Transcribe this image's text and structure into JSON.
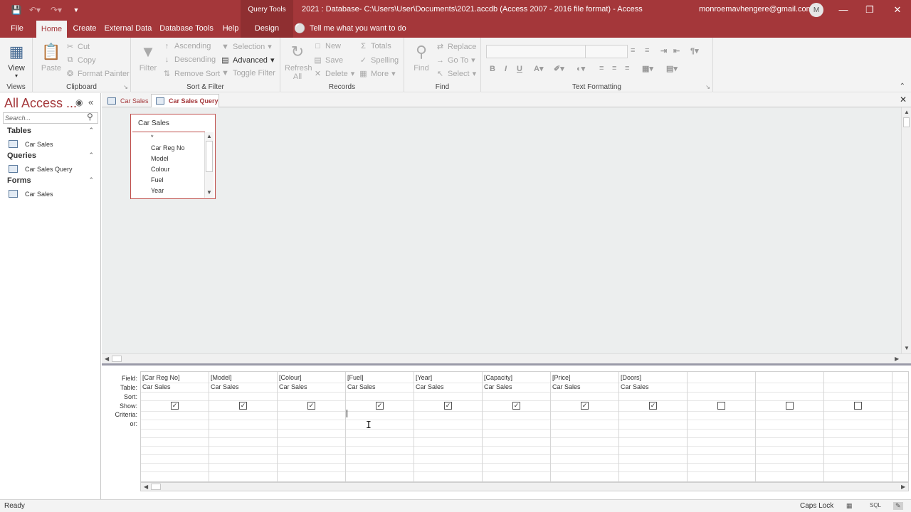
{
  "titlebar": {
    "context_tab_title": "Query Tools",
    "window_title": "2021 : Database- C:\\Users\\User\\Documents\\2021.accdb (Access 2007 - 2016 file format)  -  Access",
    "account_email": "monroemavhengere@gmail.com",
    "avatar_initial": "M",
    "qat_icons": [
      "save-icon",
      "undo-icon",
      "redo-icon",
      "customize-qat-icon"
    ]
  },
  "tabs": {
    "file": "File",
    "home": "Home",
    "create": "Create",
    "external_data": "External Data",
    "database_tools": "Database Tools",
    "help": "Help",
    "design": "Design",
    "tell_me": "Tell me what you want to do"
  },
  "ribbon": {
    "views": {
      "label": "Views",
      "view_button": "View"
    },
    "clipboard": {
      "label": "Clipboard",
      "paste": "Paste",
      "cut": "Cut",
      "copy": "Copy",
      "format_painter": "Format Painter"
    },
    "sort_filter": {
      "label": "Sort & Filter",
      "filter": "Filter",
      "ascending": "Ascending",
      "descending": "Descending",
      "remove_sort": "Remove Sort",
      "selection": "Selection",
      "advanced": "Advanced",
      "toggle_filter": "Toggle Filter"
    },
    "records": {
      "label": "Records",
      "refresh_all": "Refresh",
      "refresh_all_2": "All",
      "new": "New",
      "save": "Save",
      "delete": "Delete",
      "totals": "Totals",
      "spelling": "Spelling",
      "more": "More"
    },
    "find": {
      "label": "Find",
      "find": "Find",
      "replace": "Replace",
      "go_to": "Go To",
      "select": "Select"
    },
    "text_formatting": {
      "label": "Text Formatting",
      "bold": "B",
      "italic": "I",
      "underline": "U"
    }
  },
  "nav": {
    "title": "All Access ...",
    "search_placeholder": "Search...",
    "sections": [
      {
        "header": "Tables",
        "items": [
          "Car Sales"
        ]
      },
      {
        "header": "Queries",
        "items": [
          "Car Sales Query"
        ]
      },
      {
        "header": "Forms",
        "items": [
          "Car Sales"
        ]
      }
    ]
  },
  "doc_tabs": [
    "Car Sales",
    "Car Sales Query"
  ],
  "field_list": {
    "title": "Car Sales",
    "fields": [
      "*",
      "Car Reg No",
      "Model",
      "Colour",
      "Fuel",
      "Year"
    ]
  },
  "qbe": {
    "row_labels": [
      "Field:",
      "Table:",
      "Sort:",
      "Show:",
      "Criteria:",
      "or:"
    ],
    "columns": [
      {
        "field": "[Car Reg No]",
        "table": "Car Sales",
        "show": true
      },
      {
        "field": "[Model]",
        "table": "Car Sales",
        "show": true
      },
      {
        "field": "[Colour]",
        "table": "Car Sales",
        "show": true
      },
      {
        "field": "[Fuel]",
        "table": "Car Sales",
        "show": true
      },
      {
        "field": "[Year]",
        "table": "Car Sales",
        "show": true
      },
      {
        "field": "[Capacity]",
        "table": "Car Sales",
        "show": true
      },
      {
        "field": "[Price]",
        "table": "Car Sales",
        "show": true
      },
      {
        "field": "[Doors]",
        "table": "Car Sales",
        "show": true
      },
      {
        "field": "",
        "table": "",
        "show": false
      },
      {
        "field": "",
        "table": "",
        "show": false
      },
      {
        "field": "",
        "table": "",
        "show": false
      }
    ]
  },
  "status": {
    "text": "Ready",
    "caps_lock": "Caps Lock",
    "sql_label": "SQL"
  },
  "colors": {
    "accent": "#a4373a",
    "ribbon_bg": "#f3f3f3",
    "canvas_bg": "#eceeee"
  }
}
